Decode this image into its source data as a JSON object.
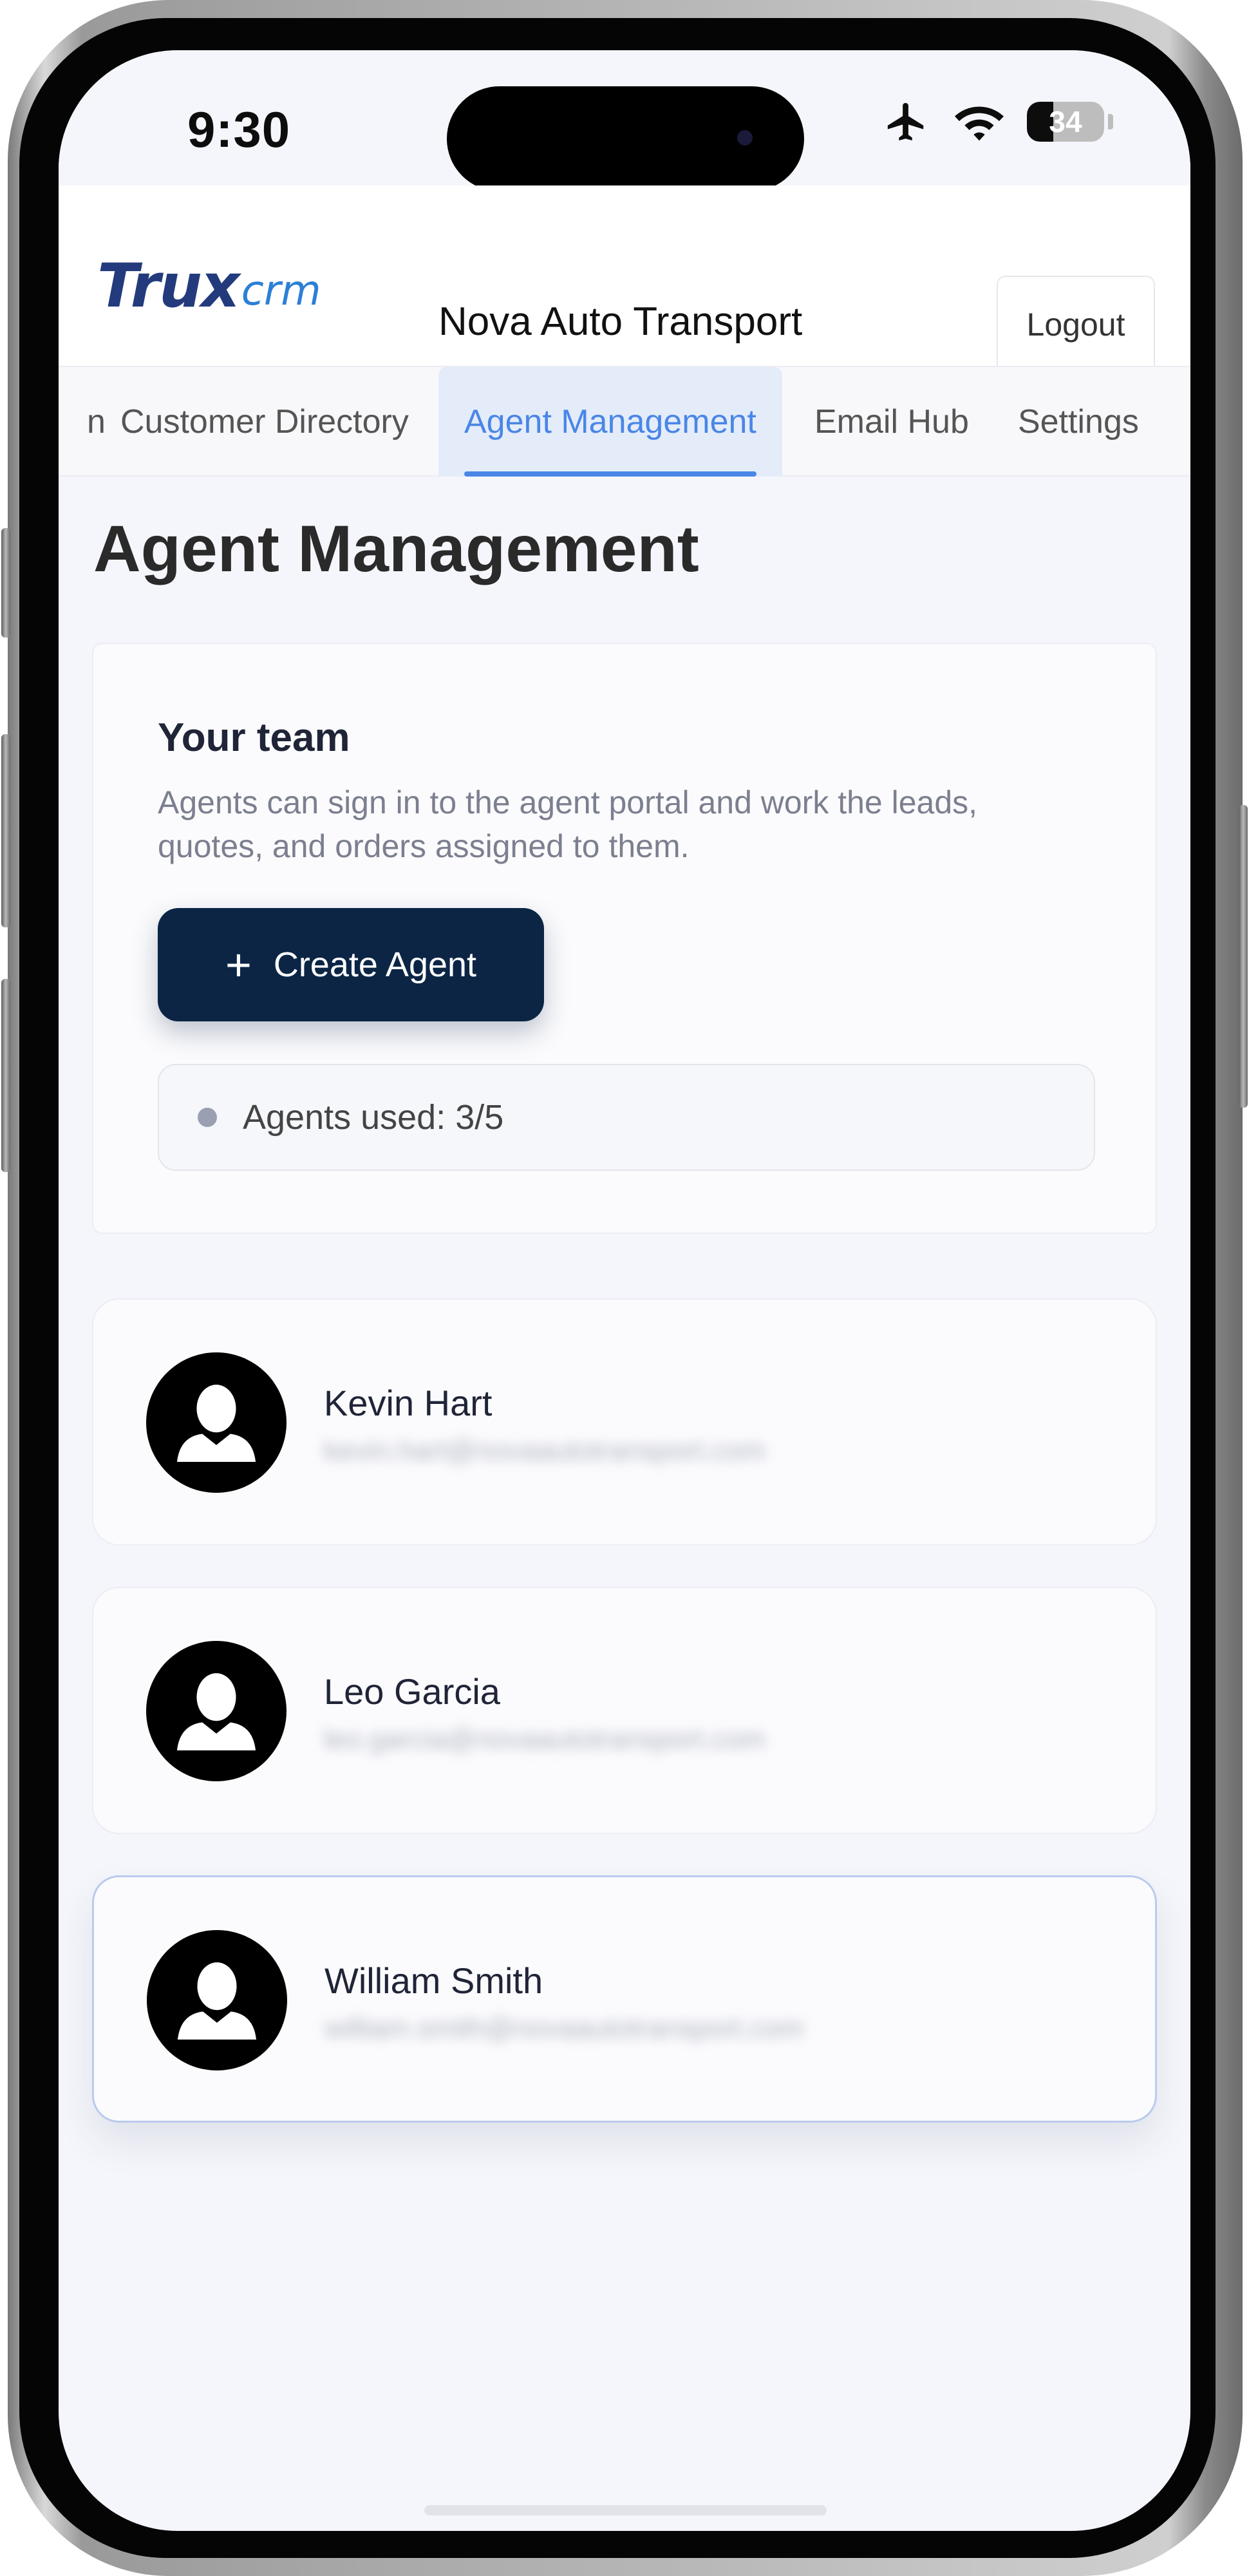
{
  "status_bar": {
    "time": "9:30",
    "battery_level": "34",
    "icons": [
      "airplane-icon",
      "wifi-icon",
      "battery-icon"
    ]
  },
  "header": {
    "logo_mark": "Trux",
    "logo_sub": "crm",
    "company": "Nova Auto Transport",
    "logout_label": "Logout"
  },
  "tabs": [
    {
      "label": "n",
      "active": false
    },
    {
      "label": "Customer Directory",
      "active": false
    },
    {
      "label": "Agent Management",
      "active": true
    },
    {
      "label": "Email Hub",
      "active": false
    },
    {
      "label": "Settings",
      "active": false
    }
  ],
  "page": {
    "title": "Agent Management"
  },
  "team": {
    "title": "Your team",
    "description": "Agents can sign in to the agent portal and work the leads, quotes, and orders assigned to them.",
    "create_label": "Create Agent",
    "usage": "Agents used: 3/5"
  },
  "agents": [
    {
      "name": "Kevin Hart",
      "email": "kevin.hart@novaautotransport.com"
    },
    {
      "name": "Leo Garcia",
      "email": "leo.garcia@novaautotransport.com"
    },
    {
      "name": "William Smith",
      "email": "william.smith@novaautotransport.com"
    }
  ],
  "colors": {
    "accent": "#4a86e6",
    "primary_button": "#0c2545",
    "logo_blue": "#233b7d"
  }
}
